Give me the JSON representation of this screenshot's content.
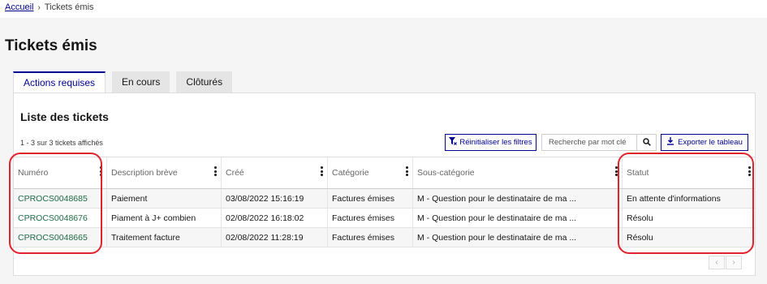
{
  "breadcrumb": {
    "home": "Accueil",
    "separator": "›",
    "current": "Tickets émis"
  },
  "page": {
    "title": "Tickets émis"
  },
  "tabs": [
    {
      "label": "Actions requises",
      "active": true
    },
    {
      "label": "En cours",
      "active": false
    },
    {
      "label": "Clôturés",
      "active": false
    }
  ],
  "card": {
    "title": "Liste des tickets",
    "count_text": "1 - 3 sur 3 tickets affichés",
    "reset_label": "Réinitialiser les filtres",
    "search_placeholder": "Recherche par mot clé",
    "export_label": "Exporter le tableau"
  },
  "table": {
    "columns": [
      "Numéro",
      "Description brève",
      "Créé",
      "Catégorie",
      "Sous-catégorie",
      "Statut"
    ],
    "rows": [
      [
        "CPROCS0048685",
        "Paiement",
        "03/08/2022 15:16:19",
        "Factures émises",
        "M - Question pour le destinataire de ma ...",
        "En attente d'informations"
      ],
      [
        "CPROCS0048676",
        "Piament à J+ combien",
        "02/08/2022 16:18:02",
        "Factures émises",
        "M - Question pour le destinataire de ma ...",
        "Résolu"
      ],
      [
        "CPROCS0048665",
        "Traitement facture",
        "02/08/2022 11:28:19",
        "Factures émises",
        "M - Question pour le destinataire de ma ...",
        "Résolu"
      ]
    ]
  },
  "pager": {
    "prev": "‹",
    "next": "›"
  },
  "colors": {
    "accent": "#000091",
    "link": "#1f6b47",
    "highlight": "#e0242e"
  }
}
